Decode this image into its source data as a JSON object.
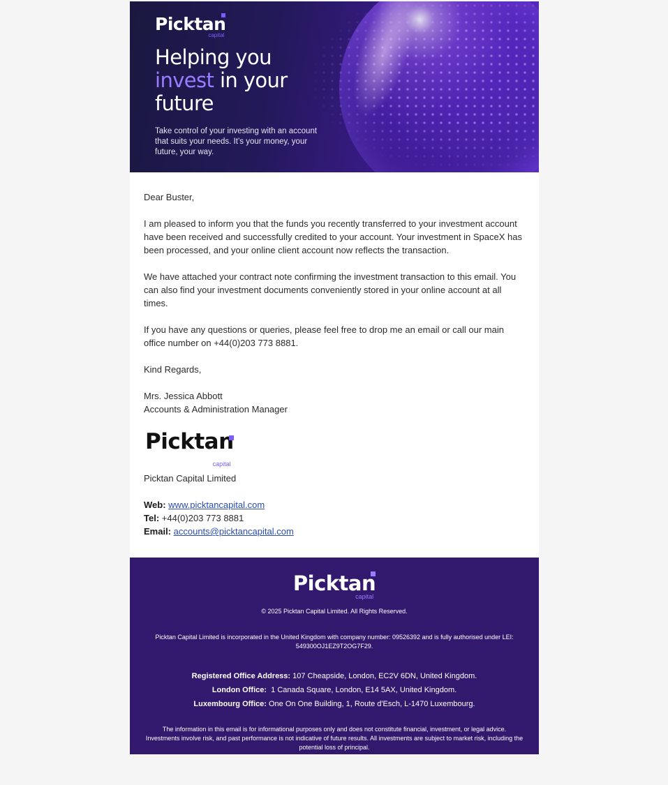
{
  "banner": {
    "logo_text": "Picktan",
    "logo_sub": "capital",
    "headline_line1": "Helping you",
    "headline_accent": "invest",
    "headline_line2_rest": " in your",
    "headline_line3": "future",
    "tagline": "Take control of your investing with an account that suits your needs. It’s your money, your future, your way."
  },
  "body": {
    "greeting": "Dear Buster,",
    "paragraph1": "I am pleased to inform you that the funds you recently transferred to your investment account have been received and successfully credited to your account. Your investment in SpaceX has been processed, and your online client account now reflects the transaction.",
    "paragraph2": "We have attached your contract note confirming the investment transaction to this email. You can also find your investment documents conveniently stored in your online account at all times.",
    "paragraph3": "If you have any questions or queries, please feel free to drop me an email or call our main office number on +44(0)203 773 8881.",
    "closing": "Kind Regards,",
    "signature_name": "Mrs. Jessica Abbott",
    "signature_title": "Accounts & Administration Manager",
    "logo_text": "Picktan",
    "logo_sub": "capital",
    "company": "Picktan Capital Limited",
    "web_label": "Web:",
    "web_value": "www.picktancapital.com",
    "tel_label": "Tel:",
    "tel_value": "+44(0)203 773 8881",
    "email_label": "Email:",
    "email_value": "accounts@picktancapital.com"
  },
  "footer": {
    "logo_text": "Picktan",
    "logo_sub": "capital",
    "copyright": "© 2025 Picktan Capital Limited. All Rights Reserved.",
    "legal": "Picktan Capital Limited is incorporated in the United Kingdom with company number: 09526392 and is fully authorised under LEI: 549300OJ1EZ9T2OG7F29.",
    "registered_label": "Registered Office Address:",
    "registered_value": " 107 Cheapside, London, EC2V 6DN, United Kingdom.",
    "london_label": "London Office:",
    "london_value": "  1 Canada Square, London, E14 5AX, United Kingdom.",
    "luxembourg_label": "Luxembourg Office:",
    "luxembourg_value": " One On One Building, 1, Route d'Esch, L-1470 Luxembourg.",
    "disclaimer": "The information in this email is for informational purposes only and does not constitute financial, investment, or legal advice. Investments involve risk, and past performance is not indicative of future results. All investments are subject to market risk, including the potential loss of principal."
  },
  "colors": {
    "brand_purple": "#7c5cff",
    "footer_bg": "#32196e",
    "link": "#2a4db3"
  }
}
